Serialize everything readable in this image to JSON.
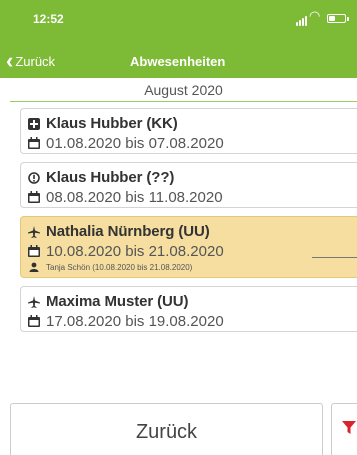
{
  "status_bar": {
    "time": "12:52"
  },
  "nav": {
    "back_label": "Zurück",
    "title": "Abwesenheiten"
  },
  "month": "August 2020",
  "colors": {
    "header": "#7dba36",
    "selected": "#f5dea0",
    "filter_icon": "#d9232d"
  },
  "absences": [
    {
      "name": "Klaus Hubber (KK)",
      "name_icon": "medical-cross-icon",
      "dates": "01.08.2020 bis 07.08.2020",
      "selected": false
    },
    {
      "name": "Klaus Hubber (??)",
      "name_icon": "info-circle-icon",
      "dates": "08.08.2020 bis 11.08.2020",
      "selected": false
    },
    {
      "name": "Nathalia Nürnberg (UU)",
      "name_icon": "airplane-icon",
      "dates": "10.08.2020 bis 21.08.2020",
      "selected": true,
      "substitute": "Tanja Schön (10.08.2020 bis 21.08.2020)"
    },
    {
      "name": "Maxima Muster (UU)",
      "name_icon": "airplane-icon",
      "dates": "17.08.2020 bis 19.08.2020",
      "selected": false
    }
  ],
  "footer": {
    "back_button": "Zurück",
    "filter_icon": "filter-icon"
  }
}
